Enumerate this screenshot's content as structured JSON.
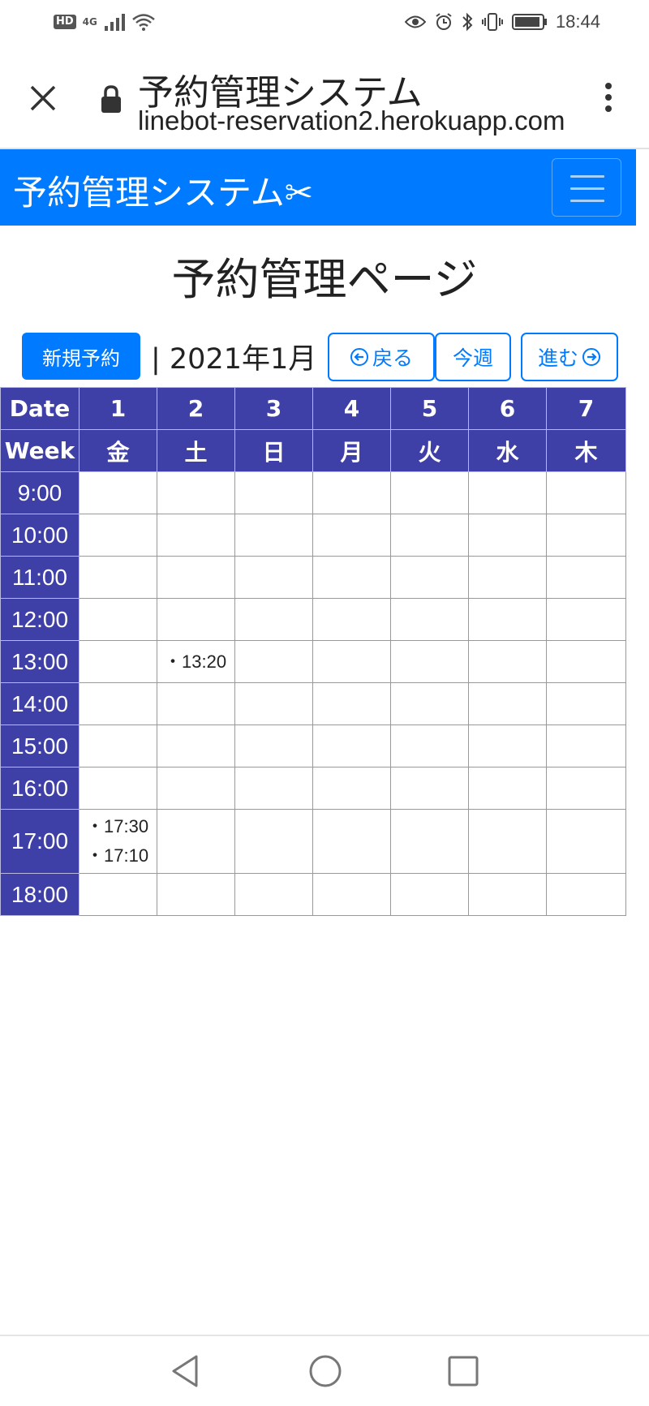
{
  "status_bar": {
    "hd": "HD",
    "network": "4G",
    "time": "18:44"
  },
  "browser": {
    "title": "予約管理システム",
    "url": "linebot-reservation2.herokuapp.com"
  },
  "navbar": {
    "brand": "予約管理システム✂"
  },
  "page": {
    "title": "予約管理ページ"
  },
  "controls": {
    "new_label": "新規予約",
    "month_label": "| 2021年1月 |",
    "prev_label": "戻る",
    "today_label": "今週",
    "next_label": "進む"
  },
  "calendar": {
    "date_header": "Date",
    "week_header": "Week",
    "dates": [
      "1",
      "2",
      "3",
      "4",
      "5",
      "6",
      "7"
    ],
    "weekdays": [
      "金",
      "土",
      "日",
      "月",
      "火",
      "水",
      "木"
    ],
    "times": [
      "9:00",
      "10:00",
      "11:00",
      "12:00",
      "13:00",
      "14:00",
      "15:00",
      "16:00",
      "17:00",
      "18:00"
    ],
    "reservations": {
      "13:00": {
        "2": [
          "・13:20"
        ]
      },
      "17:00": {
        "1": [
          "・17:30",
          "・17:10"
        ]
      }
    }
  },
  "colors": {
    "primary": "#007bff",
    "table_header": "#3f3fa8"
  }
}
